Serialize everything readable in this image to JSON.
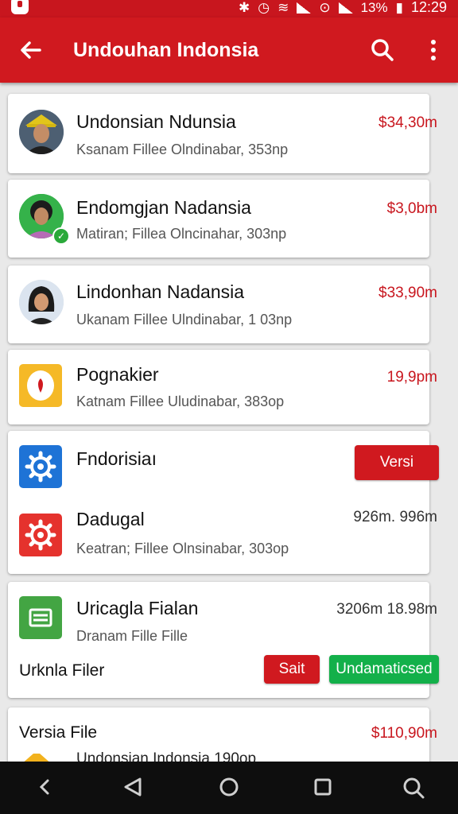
{
  "status": {
    "battery": "13%",
    "time": "12:29"
  },
  "appbar": {
    "title": "Undouhan Indonsia"
  },
  "items": [
    {
      "name": "Undonsian Ndunsia",
      "sub": "Ksanam Fillee Olndinabar, 353np",
      "price": "$34,30m"
    },
    {
      "name": "Endomgjan Nadansia",
      "sub": "Matiran; Fillea Olncinahar, 303np",
      "price": "$3,0bm"
    },
    {
      "name": "Lindonhan Nadansia",
      "sub": "Ukanam Fillee Ulndinabar, 1 03np",
      "price": "$33,90m"
    },
    {
      "name": "Pognakier",
      "sub": "Katnam Fillee Uludinabar, 383op",
      "price": "19,9pm"
    }
  ],
  "group": {
    "first_name": "Fndorisiaı",
    "button": "Versi",
    "second_name": "Dadugal",
    "second_price": "926m. 996m",
    "second_sub": "Keatran; Fillee Olnsinabar, 303op"
  },
  "file_card": {
    "name": "Uricagla Fialan",
    "price": "3206m 18.98m",
    "sub": "Dranam Fille Fille",
    "footer_label": "Urknla Filer",
    "button_red": "Sait",
    "button_green": "Undamaticsed"
  },
  "last_card": {
    "title": "Versia File",
    "price": "$110,90m",
    "partial_text": "Undonsian Indonsia 190op"
  },
  "colors": {
    "primary": "#d0191f",
    "green": "#13b04a",
    "status_red": "#c8161e"
  }
}
